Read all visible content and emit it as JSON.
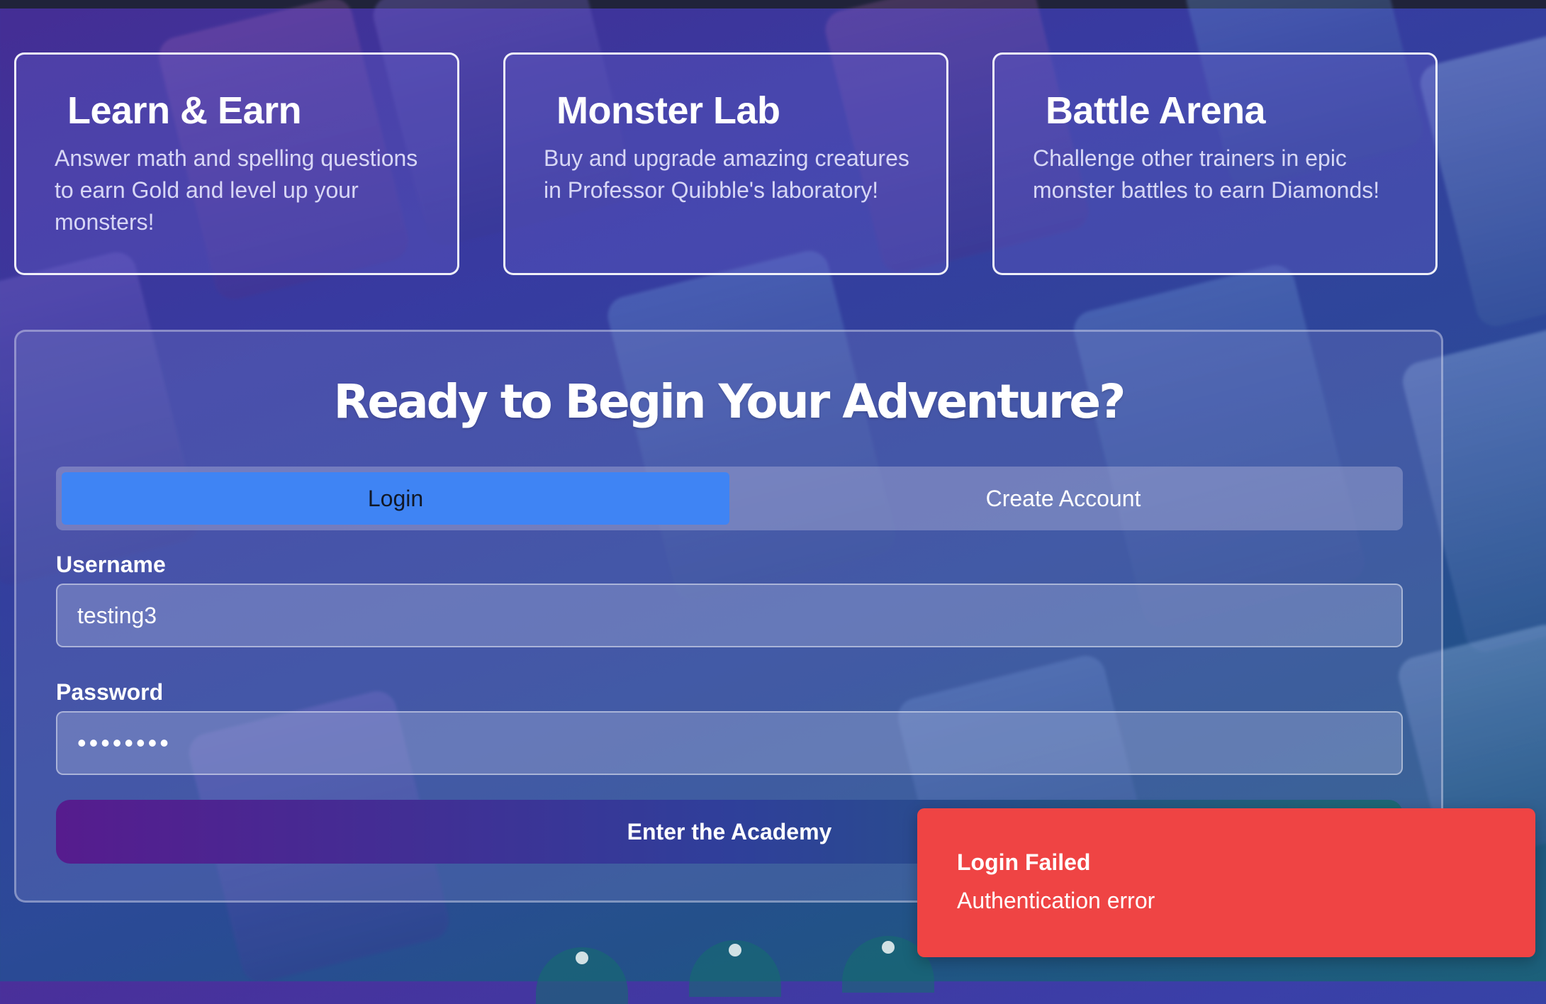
{
  "features": [
    {
      "title": "Learn & Earn",
      "description": "Answer math and spelling questions to earn Gold and level up your monsters!"
    },
    {
      "title": "Monster Lab",
      "description": "Buy and upgrade amazing creatures in Professor Quibble's laboratory!"
    },
    {
      "title": "Battle Arena",
      "description": "Challenge other trainers in epic monster battles to earn Diamonds!"
    }
  ],
  "auth": {
    "heading": "Ready to Begin Your Adventure?",
    "tabs": {
      "login": "Login",
      "create_account": "Create Account",
      "active": "login"
    },
    "username": {
      "label": "Username",
      "value": "testing3"
    },
    "password": {
      "label": "Password",
      "value": "••••••••"
    },
    "submit_label": "Enter the Academy"
  },
  "toast": {
    "title": "Login Failed",
    "message": "Authentication error",
    "color": "#ef4444"
  },
  "colors": {
    "active_tab": "#3f84f4",
    "submit_gradient": [
      "#561c8e",
      "#2f3f9a",
      "#1e6874"
    ]
  }
}
